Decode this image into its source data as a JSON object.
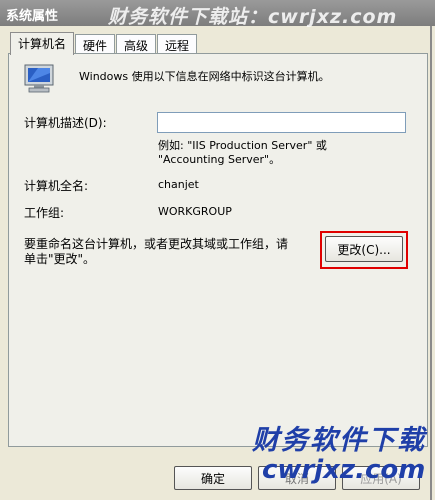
{
  "window": {
    "title": "系统属性",
    "watermark_top": "财务软件下载站：cwrjxz.com"
  },
  "tabs": [
    {
      "label": "计算机名",
      "active": true
    },
    {
      "label": "硬件",
      "active": false
    },
    {
      "label": "高级",
      "active": false
    },
    {
      "label": "远程",
      "active": false
    }
  ],
  "intro_text": "Windows 使用以下信息在网络中标识这台计算机。",
  "description": {
    "label": "计算机描述(D):",
    "value": "",
    "example_line1": "例如: \"IIS Production Server\" 或",
    "example_line2": "\"Accounting Server\"。"
  },
  "full_name": {
    "label": "计算机全名:",
    "value": "chanjet"
  },
  "workgroup": {
    "label": "工作组:",
    "value": "WORKGROUP"
  },
  "rename": {
    "text_line1": "要重命名这台计算机，或者更改其域或工作组，请",
    "text_line2": "单击\"更改\"。",
    "change_button": "更改(C)..."
  },
  "footer": {
    "ok_label": "确定",
    "cancel_label": "取消",
    "apply_label": "应用(A)"
  },
  "watermark_bottom": {
    "line1": "财务软件下载",
    "line2": "cwrjxz.com"
  },
  "colors": {
    "highlight": "#e00000",
    "watermark": "#1f3fa8"
  }
}
